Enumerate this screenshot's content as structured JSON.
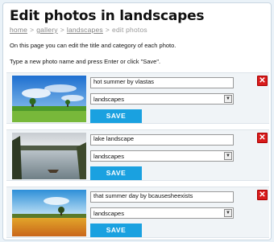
{
  "page": {
    "title": "Edit photos in landscapes",
    "breadcrumb": [
      {
        "label": "home",
        "link": true
      },
      {
        "label": "gallery",
        "link": true
      },
      {
        "label": "landscapes",
        "link": true
      },
      {
        "label": "edit photos",
        "link": false
      }
    ],
    "separator": ">",
    "intro_1": "On this page you can edit the title and category of each photo.",
    "intro_2": "Type a new photo name and press Enter or click \"Save\"."
  },
  "photos": [
    {
      "name": "hot summer by vlastas",
      "category": "landscapes",
      "save_label": "SAVE",
      "delete_label": "✕"
    },
    {
      "name": "lake landscape",
      "category": "landscapes",
      "save_label": "SAVE",
      "delete_label": "✕"
    },
    {
      "name": "that summer day by bcausesheexists",
      "category": "landscapes",
      "save_label": "SAVE",
      "delete_label": "✕"
    }
  ],
  "select_arrow": "▼",
  "colors": {
    "save_button": "#1aa1e0",
    "delete_button": "#d81c1c",
    "row_background": "#f0f4f7"
  }
}
